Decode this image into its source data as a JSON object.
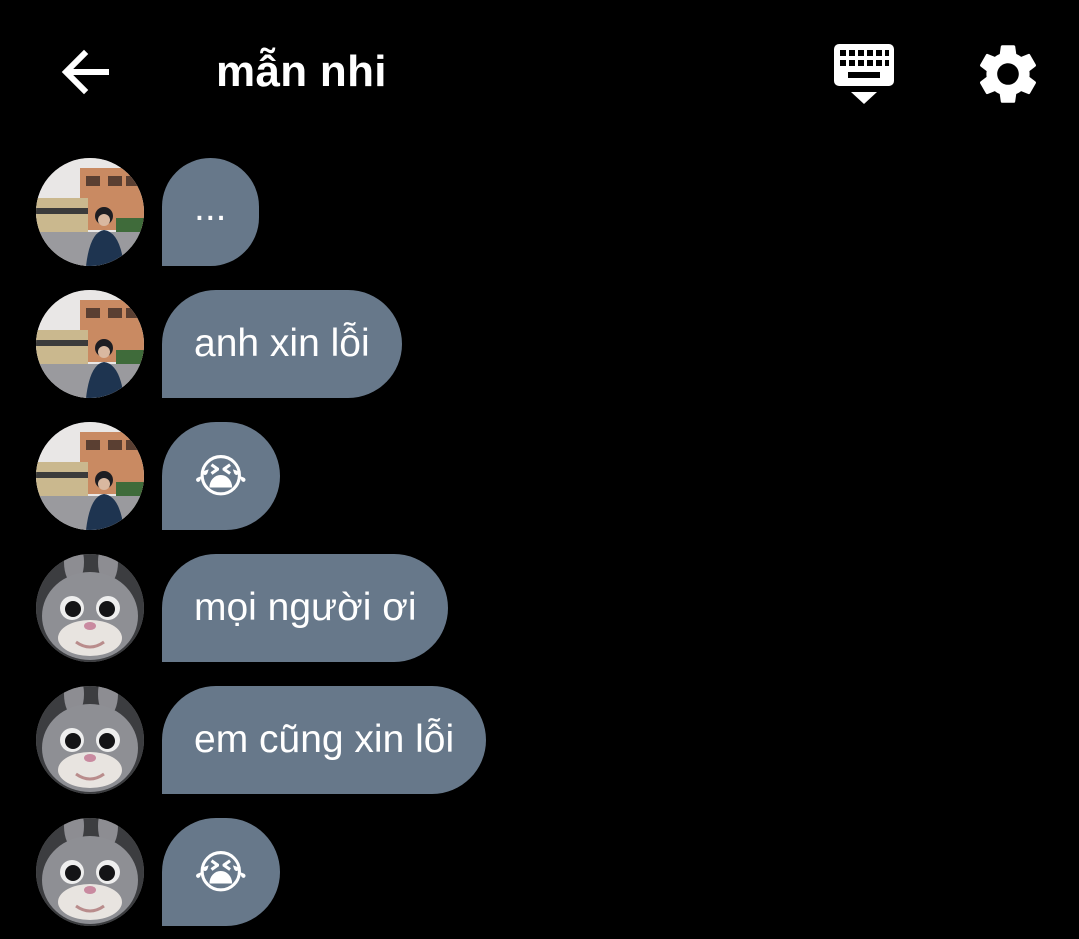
{
  "header": {
    "title": "mẫn nhi",
    "back_icon": "arrow-left-icon",
    "keyboard_icon": "keyboard-hide-icon",
    "settings_icon": "gear-icon"
  },
  "colors": {
    "background": "#000000",
    "bubble": "#67788a",
    "text": "#ffffff"
  },
  "messages": [
    {
      "sender_avatar": "boy-street-photo",
      "text": "..."
    },
    {
      "sender_avatar": "boy-street-photo",
      "text": "anh xin lỗi"
    },
    {
      "sender_avatar": "boy-street-photo",
      "text": "😭"
    },
    {
      "sender_avatar": "bunny-mascot",
      "text": "mọi người ơi"
    },
    {
      "sender_avatar": "bunny-mascot",
      "text": "em cũng xin lỗi"
    },
    {
      "sender_avatar": "bunny-mascot",
      "text": "😭"
    }
  ]
}
